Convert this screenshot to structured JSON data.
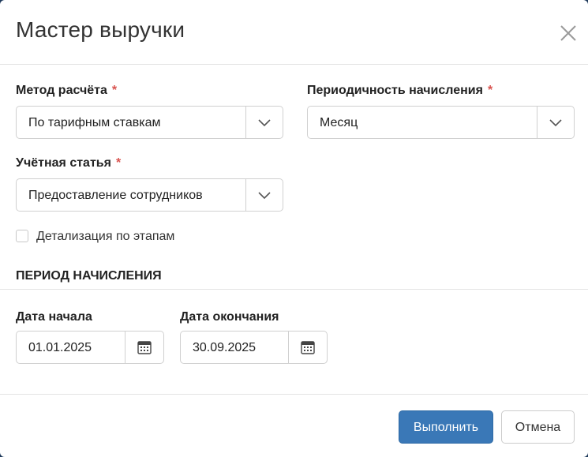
{
  "dialog": {
    "title": "Мастер выручки"
  },
  "form": {
    "method": {
      "label": "Метод расчёта",
      "required_mark": "*",
      "value": "По тарифным ставкам"
    },
    "periodicity": {
      "label": "Периодичность начисления",
      "required_mark": "*",
      "value": "Месяц"
    },
    "account_item": {
      "label": "Учётная статья",
      "required_mark": "*",
      "value": "Предоставление сотрудников"
    },
    "detail_by_stages": {
      "label": "Детализация по этапам",
      "checked": false
    }
  },
  "period": {
    "section_title": "ПЕРИОД НАЧИСЛЕНИЯ",
    "start": {
      "label": "Дата начала",
      "value": "01.01.2025"
    },
    "end": {
      "label": "Дата окончания",
      "value": "30.09.2025"
    }
  },
  "footer": {
    "execute_label": "Выполнить",
    "cancel_label": "Отмена"
  },
  "icons": {
    "close": "close-icon",
    "dropdown": "chevron-down-icon",
    "calendar": "calendar-icon"
  },
  "colors": {
    "primary": "#3a78b7",
    "required": "#d9534f",
    "border": "#d0d0d0"
  }
}
